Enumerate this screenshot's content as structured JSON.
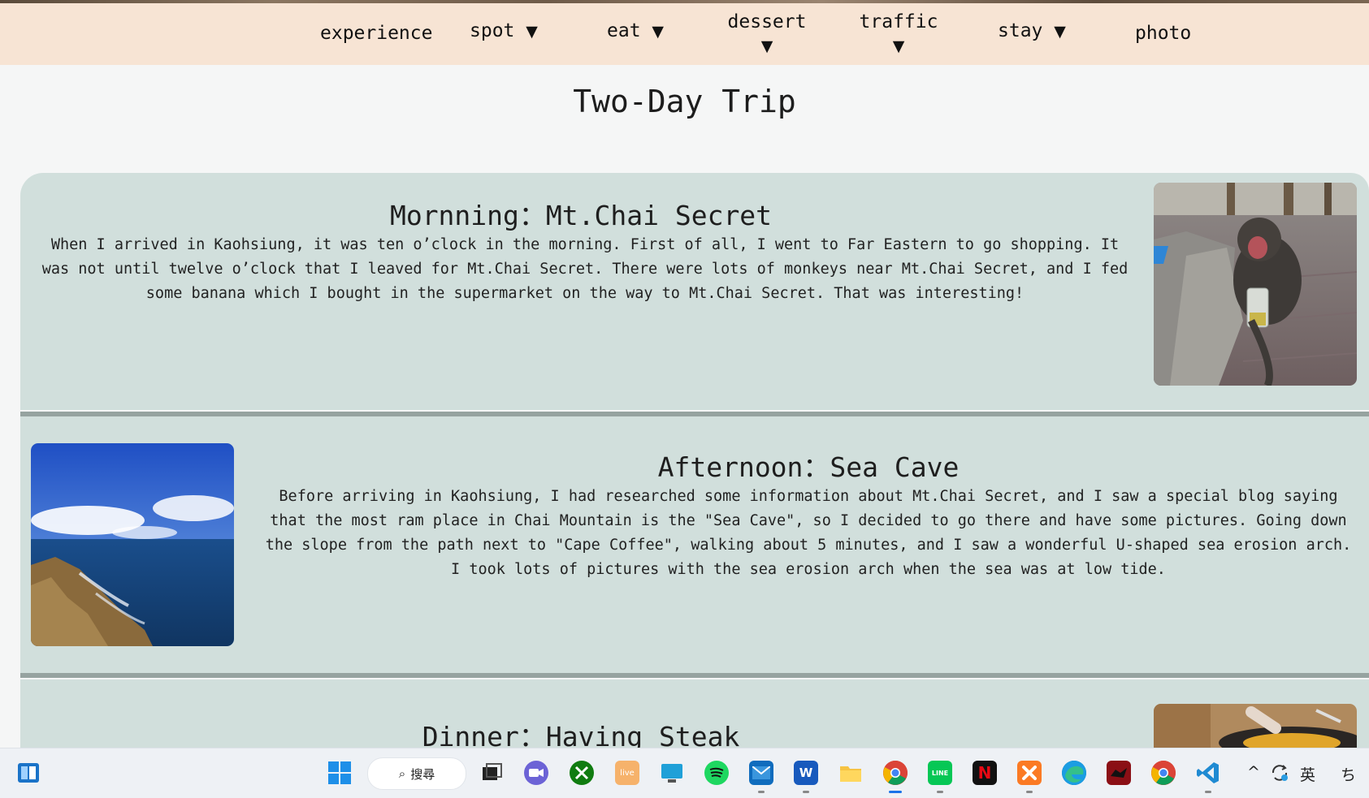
{
  "nav": {
    "items": [
      {
        "label": "experience",
        "arrow": ""
      },
      {
        "label": "spot",
        "arrow": "▼"
      },
      {
        "label": "eat",
        "arrow": "▼"
      },
      {
        "label": "dessert",
        "arrow": "▼"
      },
      {
        "label": "traffic",
        "arrow": "▼"
      },
      {
        "label": "stay",
        "arrow": "▼"
      },
      {
        "label": "photo",
        "arrow": ""
      }
    ]
  },
  "page": {
    "title": "Two-Day Trip"
  },
  "sections": [
    {
      "title": "Mornning：Mt.Chai Secret",
      "text": "When I arrived in Kaohsiung, it was ten o’clock in the morning. First of all, I went to Far Eastern to go shopping. It was not until twelve o’clock that I leaved for Mt.Chai Secret. There were lots of monkeys near Mt.Chai Secret, and I fed some banana which I bought in the supermarket on the way to Mt.Chai Secret. That was interesting!"
    },
    {
      "title": "Afternoon：Sea Cave",
      "text": "Before arriving in Kaohsiung, I had researched some information about Mt.Chai Secret, and I saw a special blog saying that the most ram place in Chai Mountain is the \"Sea Cave\", so I decided to go there and have some pictures. Going down the slope from the path next to \"Cape Coffee\", walking about 5 minutes, and I saw a wonderful U-shaped sea erosion arch. I took lots of pictures with the sea erosion arch when the sea was at low tide."
    },
    {
      "title": "Dinner：Having Steak",
      "text": ""
    }
  ],
  "taskbar": {
    "search_label": "搜尋",
    "apps": [
      "start-icon",
      "search-icon",
      "task-view-icon",
      "teams-chat-icon",
      "xbox-icon",
      "live-icon",
      "remote-desktop-icon",
      "spotify-icon",
      "mail-icon",
      "word-icon",
      "file-explorer-icon",
      "chrome-icon",
      "line-icon",
      "netflix-icon",
      "xampp-icon",
      "edge-icon",
      "game-icon",
      "chrome-icon",
      "vscode-icon"
    ],
    "live_label": "live",
    "word_label": "W",
    "netflix_label": "N",
    "line_label": "LINE",
    "tray_chevron": "^",
    "tray_lang": "英",
    "tray_extra": "ち"
  },
  "colors": {
    "nav_bg": "#f7e4d4",
    "panel_bg": "#d1dfdc",
    "divider": "#96a3a0",
    "page_bg": "#f5f6f6"
  }
}
